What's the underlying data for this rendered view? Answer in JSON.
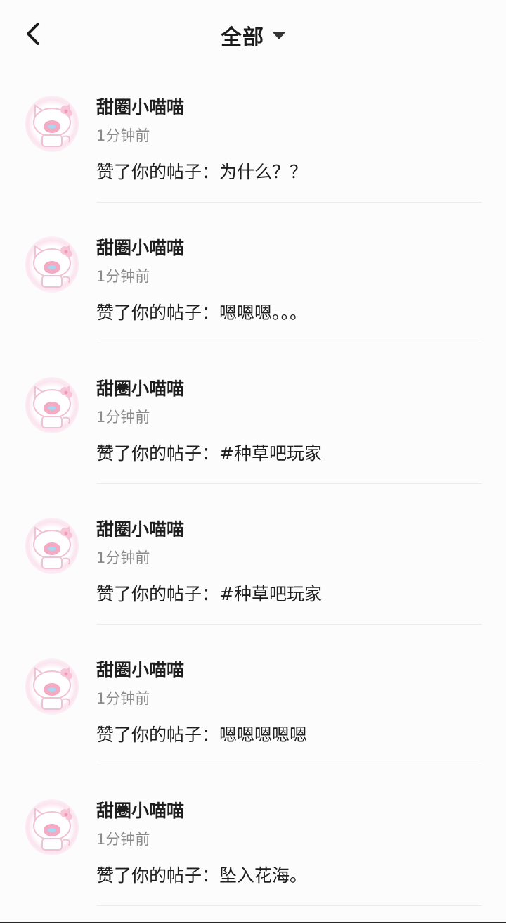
{
  "header": {
    "title": "全部"
  },
  "notifications": [
    {
      "user": "甜圈小喵喵",
      "time": "1分钟前",
      "text": "赞了你的帖子：为什么？？"
    },
    {
      "user": "甜圈小喵喵",
      "time": "1分钟前",
      "text": "赞了你的帖子：嗯嗯嗯。。。"
    },
    {
      "user": "甜圈小喵喵",
      "time": "1分钟前",
      "text": "赞了你的帖子：#种草吧玩家"
    },
    {
      "user": "甜圈小喵喵",
      "time": "1分钟前",
      "text": "赞了你的帖子：#种草吧玩家"
    },
    {
      "user": "甜圈小喵喵",
      "time": "1分钟前",
      "text": "赞了你的帖子：嗯嗯嗯嗯嗯"
    },
    {
      "user": "甜圈小喵喵",
      "time": "1分钟前",
      "text": "赞了你的帖子：坠入花海。"
    }
  ],
  "colors": {
    "text": "#1e1e1e",
    "muted": "#8b8b8b",
    "divider": "#ececec",
    "avatar_pink": "#f4a9c4",
    "avatar_blue": "#a9d8ee"
  },
  "icons": {
    "back": "chevron-left-icon",
    "dropdown": "caret-down-icon",
    "avatar": "kitty-avatar-icon"
  }
}
